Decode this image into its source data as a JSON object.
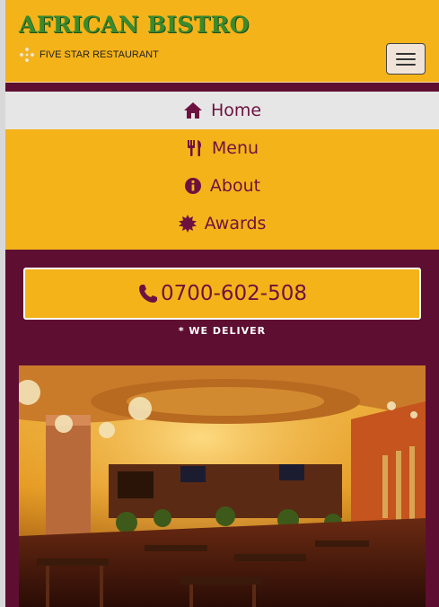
{
  "header": {
    "brand": "AFRICAN BISTRO",
    "tagline": "FIVE STAR RESTAURANT",
    "tagline_icon": "stars-icon",
    "menu_toggle_icon": "hamburger-icon"
  },
  "nav": {
    "items": [
      {
        "label": "Home",
        "icon": "home-icon",
        "active": true
      },
      {
        "label": "Menu",
        "icon": "cutlery-icon",
        "active": false
      },
      {
        "label": "About",
        "icon": "info-circle-icon",
        "active": false
      },
      {
        "label": "Awards",
        "icon": "certificate-icon",
        "active": false
      }
    ]
  },
  "main": {
    "phone": "0700-602-508",
    "phone_icon": "phone-icon",
    "deliver_note": "* WE DELIVER",
    "photo_subject": "restaurant-interior-photo"
  },
  "colors": {
    "accent": "#f5b31a",
    "maroon": "#5e0e31",
    "nav_text": "#6d1240",
    "brand_green": "#3a8a2e"
  }
}
